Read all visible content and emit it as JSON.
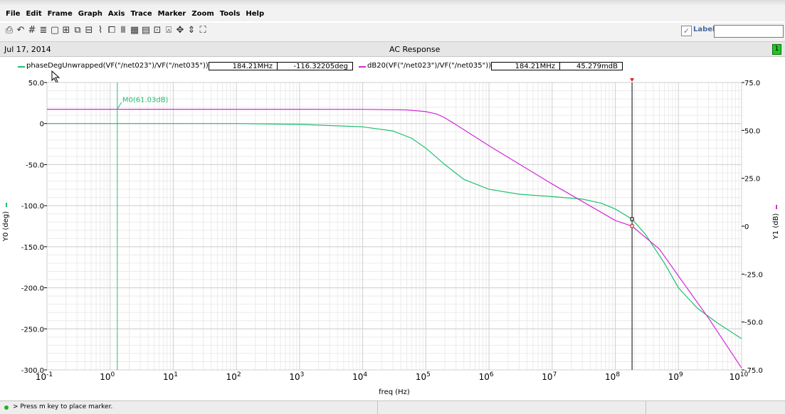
{
  "menu": [
    "File",
    "Edit",
    "Frame",
    "Graph",
    "Axis",
    "Trace",
    "Marker",
    "Zoom",
    "Tools",
    "Help"
  ],
  "toolbar": {
    "icons": [
      "print-icon",
      "undo-icon",
      "grid-icon",
      "strips-icon",
      "box-icon",
      "zoom-fit-icon",
      "copy-icon",
      "paste-icon",
      "trace-icon",
      "subwin-icon",
      "axis-icon",
      "chart-icon",
      "table-icon",
      "calc-icon",
      "marker-icon",
      "crosshair-icon",
      "delta-icon",
      "fit-icon"
    ],
    "label_text": "Label",
    "label_checked": true,
    "label_value": ""
  },
  "info": {
    "date": "Jul 17, 2014",
    "title": "AC Response",
    "status_badge": "1",
    "status_color": "#21c521"
  },
  "legend": {
    "trace0": {
      "name": "phaseDegUnwrapped(VF(\"/net023\")/VF(\"/net035\"))",
      "freq": "184.21MHz",
      "value": "-116.32205deg",
      "color": "#20c070"
    },
    "trace1": {
      "name": "dB20(VF(\"/net023\")/VF(\"/net035\"))",
      "freq": "184.21MHz",
      "value": "45.279mdB",
      "color": "#d628d6"
    }
  },
  "statusbar": {
    "message": "> Press m key to place marker."
  },
  "chart_data": {
    "type": "line",
    "xlabel": "freq (Hz)",
    "xscale": "log",
    "xlim": [
      0.1,
      10000000000
    ],
    "x_tick_labels": [
      "10-1",
      "100",
      "101",
      "102",
      "103",
      "104",
      "105",
      "106",
      "107",
      "108",
      "109",
      "1010"
    ],
    "y_left": {
      "label": "Y0 (deg)",
      "lim": [
        -300,
        50
      ],
      "ticks": [
        "50.0",
        "0",
        "-50.0",
        "-100.0",
        "-150.0",
        "-200.0",
        "-250.0",
        "-300.0"
      ]
    },
    "y_right": {
      "label": "Y1 (dB)",
      "lim": [
        -75,
        75
      ],
      "ticks": [
        "75.0",
        "50.0",
        "25.0",
        "0",
        "-25.0",
        "-50.0",
        "-75.0"
      ]
    },
    "grid": true,
    "series": [
      {
        "name": "phaseDegUnwrapped(VF(\"/net023\")/VF(\"/net035\"))",
        "axis": "left",
        "color": "#20c070",
        "x": [
          0.1,
          1,
          10,
          100,
          1000,
          10000,
          30000,
          60000,
          100000,
          200000,
          400000,
          1000000,
          3000000,
          10000000,
          30000000,
          60000000,
          100000000,
          184210000,
          300000000,
          600000000,
          1000000000,
          2000000000,
          4000000000,
          10000000000
        ],
        "y": [
          0,
          0,
          0,
          0,
          -1,
          -4,
          -9,
          -18,
          -30,
          -50,
          -68,
          -80,
          -86,
          -89,
          -92,
          -97,
          -104,
          -116.32,
          -135,
          -170,
          -200,
          -225,
          -242,
          -262
        ]
      },
      {
        "name": "dB20(VF(\"/net023\")/VF(\"/net035\"))",
        "axis": "right",
        "color": "#d628d6",
        "x": [
          0.1,
          1,
          10,
          100,
          1000,
          10000,
          50000,
          100000,
          150000,
          200000,
          300000,
          1000000,
          10000000,
          100000000,
          184210000,
          500000000,
          1000000000,
          3000000000,
          10000000000
        ],
        "y": [
          61.03,
          61.03,
          61.03,
          61.03,
          61.03,
          61.02,
          60.7,
          59.8,
          58.5,
          56.6,
          53,
          42,
          22,
          3,
          0.045,
          -12,
          -26,
          -48,
          -74
        ]
      }
    ],
    "markers": [
      {
        "label": "M0(61.03dB)",
        "x": 1.3,
        "color": "#20c070"
      }
    ],
    "cursor": {
      "x": 184210000,
      "color": "#000000"
    }
  }
}
